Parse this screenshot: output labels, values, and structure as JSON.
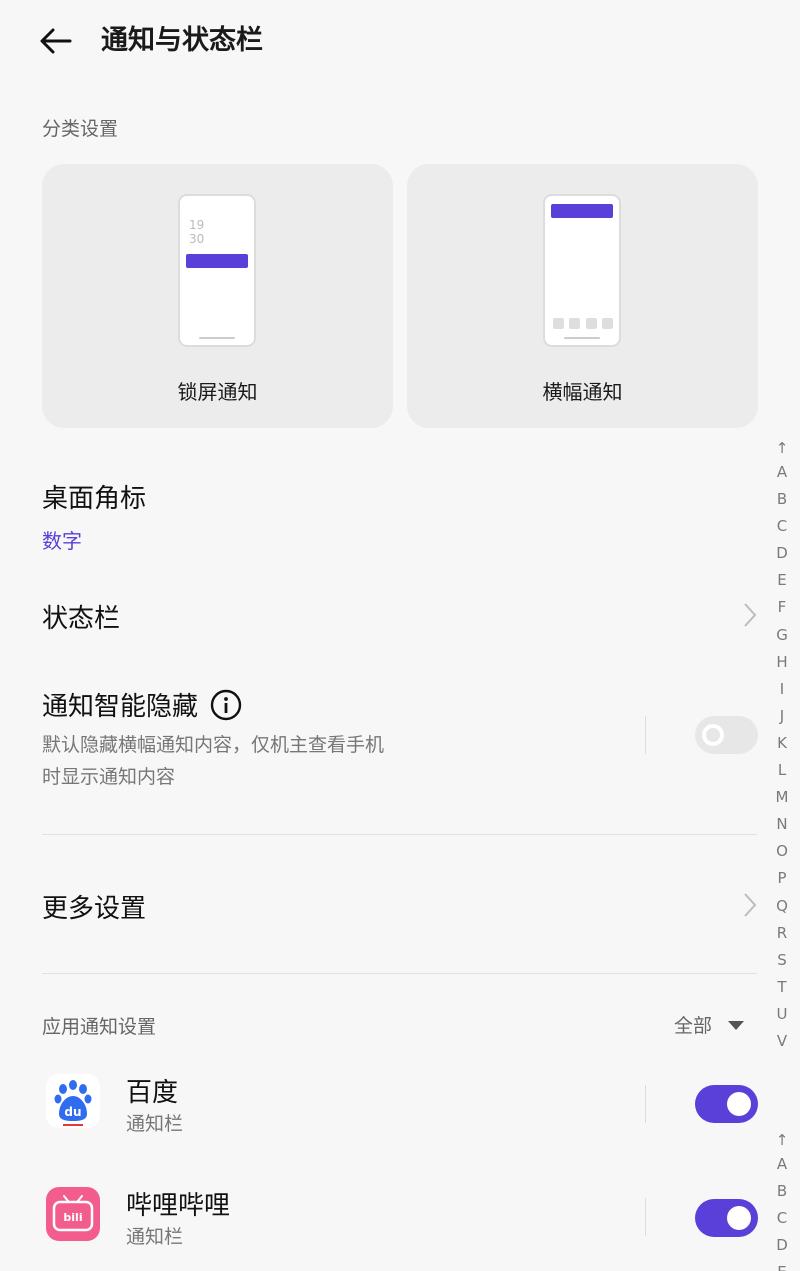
{
  "header": {
    "title": "通知与状态栏"
  },
  "category": {
    "label": "分类设置",
    "cards": [
      {
        "label": "锁屏通知",
        "clock": "19\n30"
      },
      {
        "label": "横幅通知"
      }
    ]
  },
  "badge": {
    "title": "桌面角标",
    "value": "数字"
  },
  "status_bar": {
    "title": "状态栏"
  },
  "smart_hide": {
    "title": "通知智能隐藏",
    "desc_line1": "默认隐藏横幅通知内容，仅机主查看手机",
    "desc_line2": "时显示通知内容",
    "enabled": false
  },
  "more": {
    "title": "更多设置"
  },
  "app_notifications": {
    "label": "应用通知设置",
    "filter": "全部",
    "apps": [
      {
        "name": "百度",
        "sub": "通知栏",
        "enabled": true,
        "icon": "baidu-icon"
      },
      {
        "name": "哔哩哔哩",
        "sub": "通知栏",
        "enabled": true,
        "icon": "bilibili-icon"
      }
    ]
  },
  "index_bar": {
    "top": "↑",
    "letters": [
      "A",
      "B",
      "C",
      "D",
      "E",
      "F",
      "G",
      "H",
      "I",
      "J",
      "K",
      "L",
      "M",
      "N",
      "O",
      "P",
      "Q",
      "R",
      "S",
      "T",
      "U",
      "V"
    ]
  },
  "index_bar2": {
    "top": "↑",
    "letters": [
      "A",
      "B",
      "C",
      "D",
      "E"
    ]
  },
  "colors": {
    "accent": "#5a3fd9",
    "background": "#f7f7f7"
  }
}
